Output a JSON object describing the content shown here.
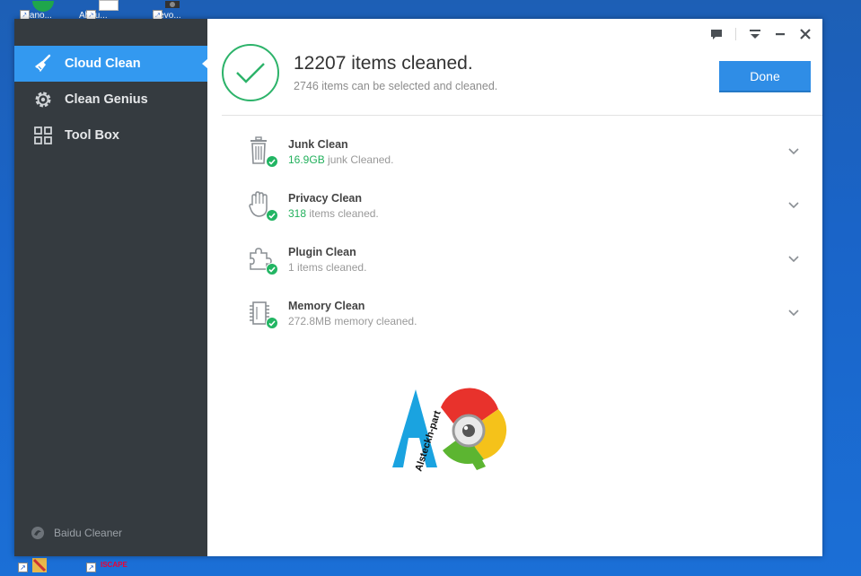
{
  "desktop": {
    "icons": [
      {
        "label": "Piano..."
      },
      {
        "label": "Abou..."
      },
      {
        "label": "Revo..."
      }
    ],
    "taskbar_text": "ISCAPE"
  },
  "sidebar": {
    "items": [
      {
        "label": "Cloud Clean",
        "icon": "broom-icon",
        "active": true
      },
      {
        "label": "Clean Genius",
        "icon": "gear-icon",
        "active": false
      },
      {
        "label": "Tool Box",
        "icon": "grid-icon",
        "active": false
      }
    ],
    "brand": "Baidu Cleaner"
  },
  "summary": {
    "count": "12207",
    "headline_suffix": "items cleaned.",
    "sub": "2746 items can be selected and cleaned."
  },
  "done_label": "Done",
  "results": [
    {
      "title": "Junk Clean",
      "value": "16.9GB",
      "suffix": "junk Cleaned.",
      "highlight": true,
      "icon": "trash-icon"
    },
    {
      "title": "Privacy Clean",
      "value": "318",
      "suffix": "items cleaned.",
      "highlight": true,
      "icon": "hand-icon"
    },
    {
      "title": "Plugin Clean",
      "value": "1",
      "suffix": "items cleaned.",
      "highlight": false,
      "icon": "puzzle-icon"
    },
    {
      "title": "Memory Clean",
      "value": "272.8MB",
      "suffix": "memory cleaned.",
      "highlight": false,
      "icon": "chip-icon"
    }
  ],
  "watermark_text": "Alsteckh-part",
  "colors": {
    "accent": "#3399f0",
    "success": "#22b563",
    "sidebar": "#353b40"
  }
}
